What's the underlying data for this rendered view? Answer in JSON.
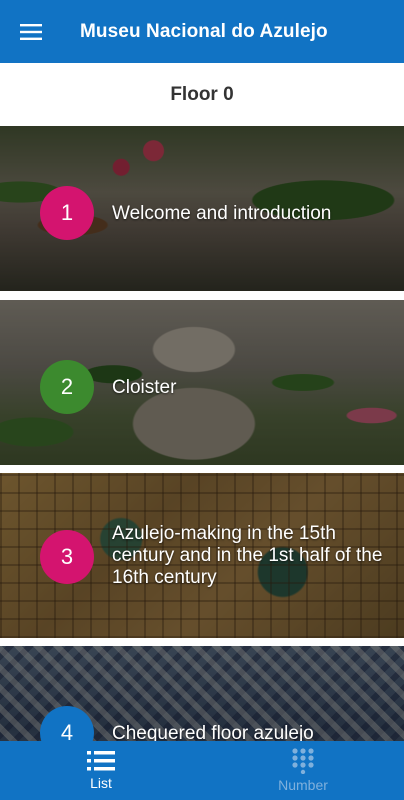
{
  "app": {
    "title": "Museu Nacional do Azulejo"
  },
  "floor": {
    "title": "Floor 0"
  },
  "items": [
    {
      "number": "1",
      "title": "Welcome and introduction",
      "badge_color": "#d4146f"
    },
    {
      "number": "2",
      "title": "Cloister",
      "badge_color": "#3c8a2e"
    },
    {
      "number": "3",
      "title": "Azulejo-making in the 15th century and in the 1st half of the 16th century",
      "badge_color": "#d4146f"
    },
    {
      "number": "4",
      "title": "Chequered floor azulejo",
      "badge_color": "#1173c4"
    }
  ],
  "nav": {
    "list_label": "List",
    "number_label": "Number",
    "list_icon": "list-icon",
    "number_icon": "dialpad-icon"
  },
  "colors": {
    "primary": "#1173c4"
  }
}
